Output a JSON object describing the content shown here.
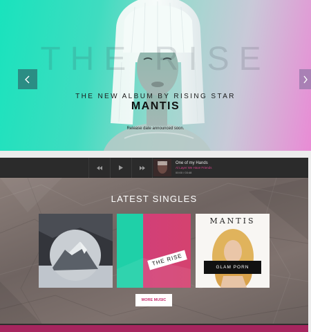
{
  "hero": {
    "big_text": "THE RISE",
    "subtitle": "THE NEW ALBUM BY RISING STAR",
    "title": "MANTIS",
    "note": "Release date announced soon."
  },
  "player": {
    "track_title": "One of my Hands",
    "artist": "Al Layer We Have Friends",
    "time": "00:00 / 03:48"
  },
  "singles": {
    "heading": "LATEST SINGLES",
    "cards": [
      {
        "label": ""
      },
      {
        "label": "THE RISE"
      },
      {
        "title": "MANTIS",
        "banner": "GLAM PORN"
      }
    ],
    "more_label": "MORE MUSIC"
  },
  "colors": {
    "accent": "#c72f6f",
    "hero_teal": "#19e3bd",
    "hero_pink": "#e98bd5",
    "dark": "#2f2d2d"
  }
}
